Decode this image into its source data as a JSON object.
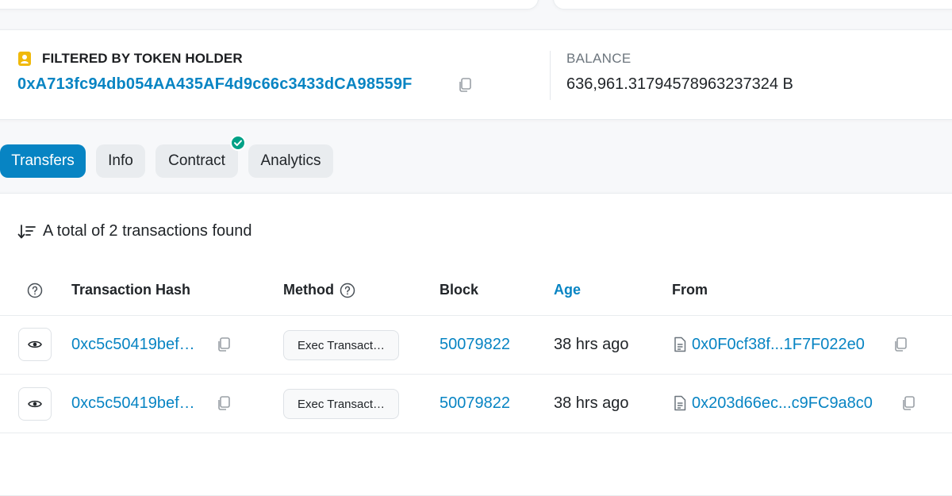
{
  "holder": {
    "label": "FILTERED BY TOKEN HOLDER",
    "address": "0xA713fc94db054AA435AF4d9c66c3433dCA98559F"
  },
  "balance": {
    "label": "BALANCE",
    "value": "636,961.31794578963237324 B"
  },
  "tabs": [
    {
      "label": "Transfers",
      "active": true
    },
    {
      "label": "Info",
      "active": false
    },
    {
      "label": "Contract",
      "active": false,
      "badge": "verified-check-icon"
    },
    {
      "label": "Analytics",
      "active": false
    }
  ],
  "summary": {
    "total_text": "A total of 2 transactions found"
  },
  "table": {
    "headers": {
      "hash": "Transaction Hash",
      "method": "Method",
      "block": "Block",
      "age": "Age",
      "from": "From"
    },
    "rows": [
      {
        "hash": "0xc5c50419bef…",
        "method": "Exec Transact…",
        "block": "50079822",
        "age": "38 hrs ago",
        "from": "0x0F0cf38f...1F7F022e0"
      },
      {
        "hash": "0xc5c50419bef…",
        "method": "Exec Transact…",
        "block": "50079822",
        "age": "38 hrs ago",
        "from": "0x203d66ec...c9FC9a8c0"
      }
    ]
  },
  "colors": {
    "link": "#0784c3",
    "active_tab": "#0784c3",
    "verified": "#00a186",
    "holder_icon": "#f0b90b"
  }
}
